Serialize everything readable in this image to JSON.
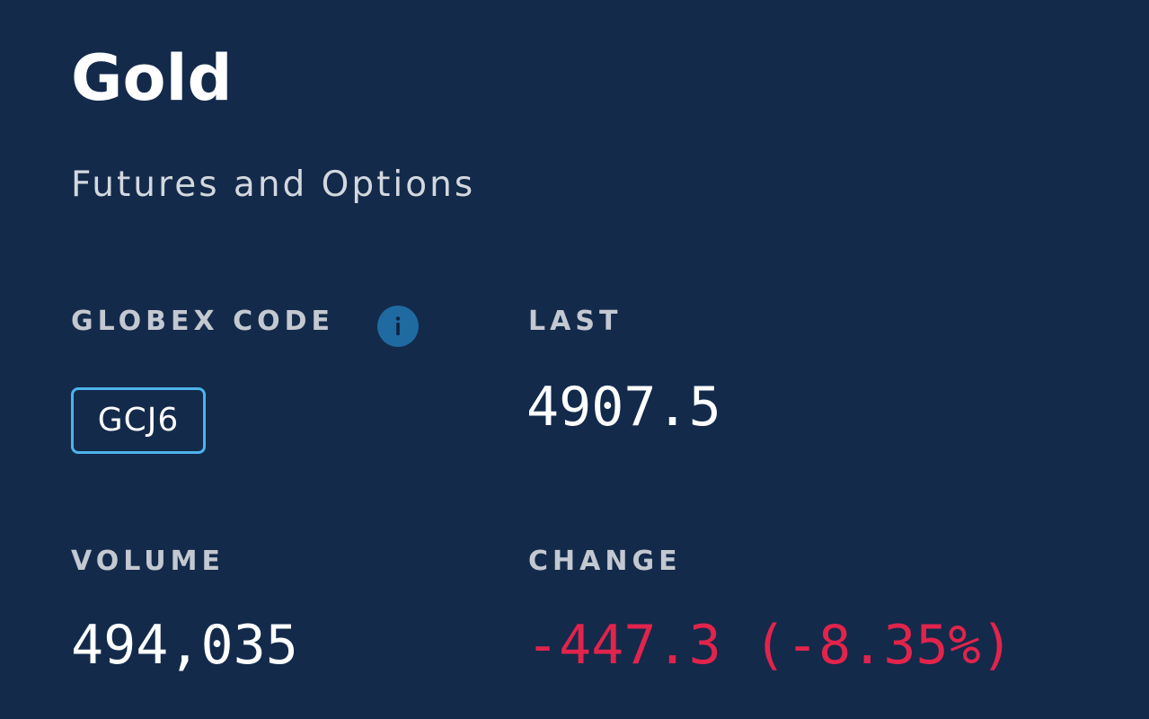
{
  "header": {
    "title": "Gold",
    "subtitle": "Futures and Options"
  },
  "quote": {
    "globex_label": "GLOBEX CODE",
    "globex_code": "GCJ6",
    "last_label": "LAST",
    "last_value": "4907.5",
    "volume_label": "VOLUME",
    "volume_value": "494,035",
    "change_label": "CHANGE",
    "change_value": "-447.3 (-8.35%)"
  },
  "colors": {
    "background": "#132a4b",
    "accent": "#4cb3ea",
    "info_icon": "#1f6aa1",
    "negative": "#e1244c"
  },
  "icons": {
    "info": "info-icon"
  }
}
